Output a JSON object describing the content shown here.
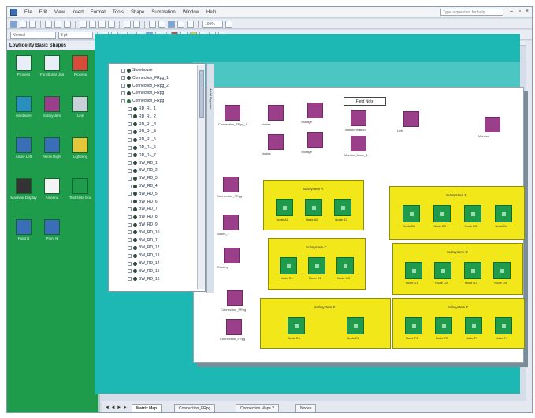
{
  "menubar": {
    "items": [
      "File",
      "Edit",
      "View",
      "Insert",
      "Format",
      "Tools",
      "Shape",
      "Summation",
      "Window",
      "Help"
    ],
    "help_search_placeholder": "Type a question for help",
    "minimize": "–",
    "restore": "▫",
    "close": "×"
  },
  "toolbar": {
    "font_select": "Normal",
    "size_select": "8 pt",
    "zoom_select": "100%"
  },
  "shapes_panel": {
    "title": "Lowfidelity Basic Shapes",
    "tiles": [
      {
        "label": "Process",
        "color": "#e8eef5",
        "icon": "rectangle-icon"
      },
      {
        "label": "Functional Unit",
        "color": "#e8eef5",
        "icon": "rectangle-icon"
      },
      {
        "label": "Process",
        "color": "#d94a3a",
        "icon": "flag-icon"
      },
      {
        "label": "Hardware",
        "color": "#2a8fbf",
        "icon": "square-icon"
      },
      {
        "label": "Subsystem",
        "color": "#9b3f8b",
        "icon": "plus-square-icon"
      },
      {
        "label": "Link",
        "color": "#c9d0d8",
        "icon": "square-icon"
      },
      {
        "label": "Arrow Left",
        "color": "#3a6fb7",
        "icon": "arrow-right-icon"
      },
      {
        "label": "Arrow Right",
        "color": "#3a6fb7",
        "icon": "arrow-right-icon"
      },
      {
        "label": "Lightning",
        "color": "#e7c63a",
        "icon": "bolt-icon"
      },
      {
        "label": "Machine Display",
        "color": "#333333",
        "icon": "monitor-icon"
      },
      {
        "label": "Antenna",
        "color": "#f4f4f4",
        "icon": "antenna-icon"
      },
      {
        "label": "Text Note Box",
        "color": "#1f9b4c",
        "icon": "note-icon"
      },
      {
        "label": "Point B",
        "color": "#3a6fb7",
        "icon": "arrow-right-icon"
      },
      {
        "label": "Point N",
        "color": "#3a6fb7",
        "icon": "arrow-right-icon"
      }
    ]
  },
  "tree": {
    "side_title": "Model Explorer",
    "rows": [
      {
        "label": "Storehouse",
        "indent": 0,
        "dot": "dark"
      },
      {
        "label": "Connection_FRpg_1",
        "indent": 0,
        "dot": "dark"
      },
      {
        "label": "Connection_FRpg_2",
        "indent": 0,
        "dot": "dark"
      },
      {
        "label": "Connection_FRpg",
        "indent": 0,
        "dot": "dark"
      },
      {
        "label": "Connection_FRpg",
        "indent": 0,
        "dot": "green"
      },
      {
        "label": "RD_RL_1",
        "indent": 1,
        "dot": "dark"
      },
      {
        "label": "RD_RL_2",
        "indent": 1,
        "dot": "dark"
      },
      {
        "label": "RD_RL_3",
        "indent": 1,
        "dot": "dark"
      },
      {
        "label": "RD_RL_4",
        "indent": 1,
        "dot": "dark"
      },
      {
        "label": "RD_RL_5",
        "indent": 1,
        "dot": "dark"
      },
      {
        "label": "RD_RL_6",
        "indent": 1,
        "dot": "dark"
      },
      {
        "label": "RD_RL_7",
        "indent": 1,
        "dot": "dark"
      },
      {
        "label": "BW_RD_1",
        "indent": 1,
        "dot": "dark"
      },
      {
        "label": "BW_RD_2",
        "indent": 1,
        "dot": "dark"
      },
      {
        "label": "BW_RD_3",
        "indent": 1,
        "dot": "dark"
      },
      {
        "label": "BW_RD_4",
        "indent": 1,
        "dot": "dark"
      },
      {
        "label": "BW_RD_5",
        "indent": 1,
        "dot": "dark"
      },
      {
        "label": "BW_RD_6",
        "indent": 1,
        "dot": "dark"
      },
      {
        "label": "BW_RD_7",
        "indent": 1,
        "dot": "dark"
      },
      {
        "label": "BW_RD_8",
        "indent": 1,
        "dot": "dark"
      },
      {
        "label": "BW_RD_9",
        "indent": 1,
        "dot": "dark"
      },
      {
        "label": "BW_RD_10",
        "indent": 1,
        "dot": "dark"
      },
      {
        "label": "BW_RD_11",
        "indent": 1,
        "dot": "dark"
      },
      {
        "label": "BW_RD_12",
        "indent": 1,
        "dot": "dark"
      },
      {
        "label": "BW_RD_13",
        "indent": 1,
        "dot": "dark"
      },
      {
        "label": "BW_RD_14",
        "indent": 1,
        "dot": "dark"
      },
      {
        "label": "BW_RD_15",
        "indent": 1,
        "dot": "dark"
      },
      {
        "label": "BW_RD_16",
        "indent": 1,
        "dot": "dark"
      }
    ]
  },
  "diagram": {
    "legend_label": "Field Note",
    "purple_nodes": [
      {
        "label": "Connection_FRpg_1"
      },
      {
        "label": "Nodes"
      },
      {
        "label": "Storage"
      },
      {
        "label": "Transformation"
      },
      {
        "label": "Link"
      },
      {
        "label": "Monitor"
      },
      {
        "label": "Nodes"
      },
      {
        "label": "Storage"
      },
      {
        "label": "Monitor_Node_1"
      },
      {
        "label": "Connection_FRpg"
      },
      {
        "label": "Nodes_F"
      },
      {
        "label": "Routing"
      },
      {
        "label": "Connection_FRpg"
      },
      {
        "label": "Connection_FRpg"
      }
    ],
    "groups": [
      {
        "title": "Subsystem A",
        "nodes": [
          "Node A1",
          "Node A2",
          "Node A3"
        ]
      },
      {
        "title": "Subsystem B",
        "nodes": [
          "Node B1",
          "Node B2",
          "Node B3",
          "Node B4"
        ]
      },
      {
        "title": "Subsystem C",
        "nodes": [
          "Node C1",
          "Node C2",
          "Node C3"
        ]
      },
      {
        "title": "Subsystem D",
        "nodes": [
          "Node D1",
          "Node D2",
          "Node D3",
          "Node D4"
        ]
      },
      {
        "title": "Subsystem E",
        "nodes": [
          "Node E1",
          "Node E2"
        ]
      },
      {
        "title": "Subsystem F",
        "nodes": [
          "Node F1",
          "Node F2",
          "Node F3",
          "Node F4"
        ]
      }
    ]
  },
  "tabs": {
    "nav": "◄ ◄ ► ►",
    "items": [
      "Matrix Map",
      "Connection_FRpg",
      "Connection Maps 2",
      "Nodes"
    ],
    "active_index": 0
  }
}
